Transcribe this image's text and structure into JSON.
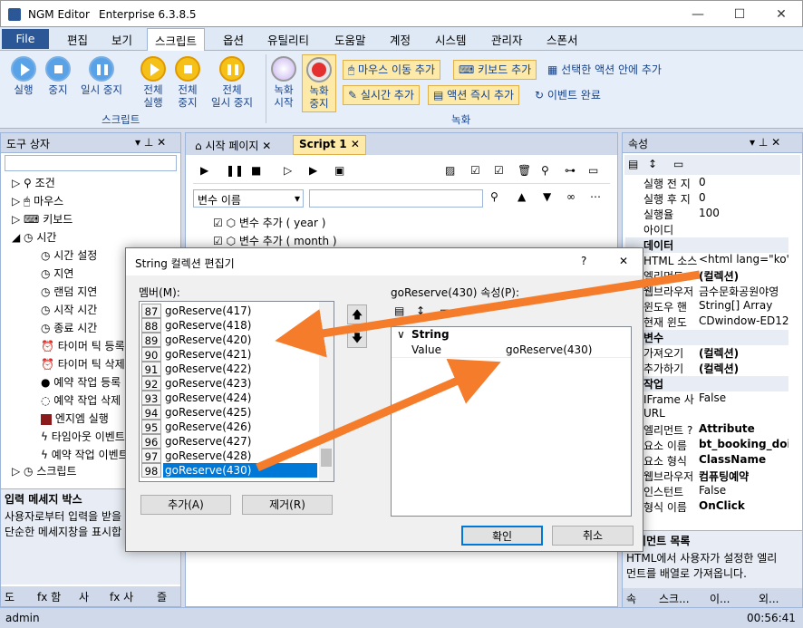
{
  "window": {
    "title": "NGM Editor",
    "edition": "Enterprise 6.3.8.5",
    "controls": [
      "—",
      "☐",
      "✕"
    ]
  },
  "menu": [
    "File",
    "편집",
    "보기",
    "스크립트",
    "옵션",
    "유틸리티",
    "도움말",
    "계정",
    "시스템",
    "관리자",
    "스폰서"
  ],
  "ribbon": {
    "script_group": "스크립트",
    "record_group": "녹화",
    "b_run": "실행",
    "b_stop": "중지",
    "b_pause": "일시 중지",
    "b_run_all_1": "전체",
    "b_run_all_2": "실행",
    "b_stop_all_1": "전체",
    "b_stop_all_2": "중지",
    "b_pause_all_1": "전체",
    "b_pause_all_2": "일시 중지",
    "b_rec_start_1": "녹화",
    "b_rec_start_2": "시작",
    "b_rec_stop_1": "녹화",
    "b_rec_stop_2": "중지",
    "b_mouse_move": "마우스 이동 추가",
    "b_keyboard": "키보드 추가",
    "b_selected_action": "선택한 액션 안에 추가",
    "b_realtime": "실시간 추가",
    "b_action_immediate": "액션 즉시 추가",
    "b_event_done": "이벤트 완료"
  },
  "toolbox": {
    "title": "도구 상자",
    "items": [
      "조건",
      "마우스",
      "키보드",
      "시간",
      "시간 설정",
      "지연",
      "랜덤 지연",
      "시작 시간",
      "종료 시간",
      "타이머 틱 등록",
      "타이머 틱 삭제",
      "예약 작업 등록",
      "예약 작업 삭제",
      "엔지엠 실행",
      "타임아웃 이벤트",
      "예약 작업 이벤트",
      "스크립트"
    ],
    "info_title": "입력 메세지 박스",
    "info_text_1": "사용자로부터 입력을 받을",
    "info_text_2": "단순한 메세지창을 표시합",
    "bottom_tabs": [
      "도",
      "fx 함",
      "사",
      "fx 사",
      "즐"
    ]
  },
  "editor": {
    "tabs": [
      "시작 페이지",
      "Script 1"
    ],
    "var_select": "변수 이름",
    "rows": [
      "변수 추가 ( year )",
      "변수 추가 ( month )"
    ]
  },
  "dialog": {
    "title": "String 컬렉션 편집기",
    "help": "?",
    "close": "✕",
    "members_label": "멤버(M):",
    "props_label": "goReserve(430) 속성(P):",
    "items": [
      {
        "n": "87",
        "v": "goReserve(417)"
      },
      {
        "n": "88",
        "v": "goReserve(418)"
      },
      {
        "n": "89",
        "v": "goReserve(420)"
      },
      {
        "n": "90",
        "v": "goReserve(421)"
      },
      {
        "n": "91",
        "v": "goReserve(422)"
      },
      {
        "n": "92",
        "v": "goReserve(423)"
      },
      {
        "n": "93",
        "v": "goReserve(424)"
      },
      {
        "n": "94",
        "v": "goReserve(425)"
      },
      {
        "n": "95",
        "v": "goReserve(426)"
      },
      {
        "n": "96",
        "v": "goReserve(427)"
      },
      {
        "n": "97",
        "v": "goReserve(428)"
      },
      {
        "n": "98",
        "v": "goReserve(430)"
      }
    ],
    "category": "String",
    "prop_key": "Value",
    "prop_value": "goReserve(430)",
    "add": "추가(A)",
    "remove": "제거(R)",
    "ok": "확인",
    "cancel": "취소"
  },
  "properties": {
    "title": "속성",
    "rows": [
      {
        "k": "실행 전 지",
        "v": "0"
      },
      {
        "k": "실행 후 지",
        "v": "0"
      },
      {
        "k": "실행율",
        "v": "100"
      },
      {
        "k": "아이디",
        "v": ""
      },
      {
        "k": "데이터",
        "v": "",
        "cat": true
      },
      {
        "k": "HTML 소스",
        "v": "<html lang=\"ko\">"
      },
      {
        "k": "엘리먼트",
        "v": "(컬렉션)"
      },
      {
        "k": "웹브라우저",
        "v": "금수문화공원야영"
      },
      {
        "k": "윈도우 핸",
        "v": "String[] Array"
      },
      {
        "k": "현재 윈도",
        "v": "CDwindow-ED12"
      },
      {
        "k": "변수",
        "v": "",
        "cat": true
      },
      {
        "k": "가져오기",
        "v": "(컬렉션)"
      },
      {
        "k": "추가하기",
        "v": "(컬렉션)"
      },
      {
        "k": "작업",
        "v": "",
        "cat": true
      },
      {
        "k": "IFrame 사",
        "v": "False"
      },
      {
        "k": "URL",
        "v": ""
      },
      {
        "k": "엘리먼트 ?",
        "v": "Attribute"
      },
      {
        "k": "요소 이름",
        "v": "bt_booking_doi"
      },
      {
        "k": "요소 형식",
        "v": "ClassName"
      },
      {
        "k": "웹브라우저",
        "v": "컴퓨팅예약"
      },
      {
        "k": "인스턴트",
        "v": "False"
      },
      {
        "k": "형식 이름",
        "v": "OnClick"
      }
    ],
    "desc_title": "엘리먼트 목록",
    "desc_1": "HTML에서 사용자가 설정한 엘리",
    "desc_2": "먼트를 배열로 가져옵니다.",
    "bottom_tabs": [
      "속",
      "스크...",
      "이...",
      "외..."
    ]
  },
  "status": {
    "user": "admin",
    "time": "00:56:41"
  },
  "colors": {
    "accent": "#2b5797",
    "arrow": "#f57c2a",
    "select": "#0078d7"
  }
}
